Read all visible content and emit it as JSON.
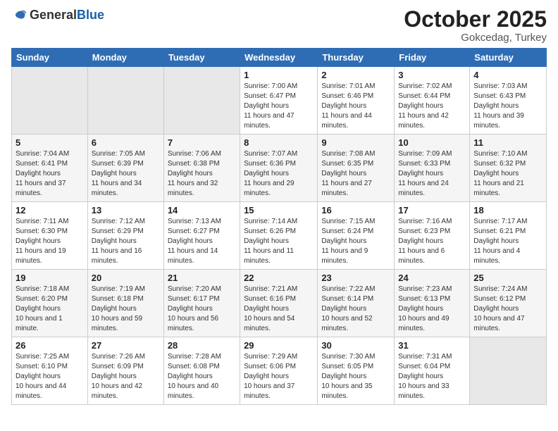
{
  "logo": {
    "general": "General",
    "blue": "Blue"
  },
  "title": {
    "month": "October 2025",
    "location": "Gokcedag, Turkey"
  },
  "weekdays": [
    "Sunday",
    "Monday",
    "Tuesday",
    "Wednesday",
    "Thursday",
    "Friday",
    "Saturday"
  ],
  "weeks": [
    [
      {
        "day": "",
        "sunrise": "",
        "sunset": "",
        "daylight": ""
      },
      {
        "day": "",
        "sunrise": "",
        "sunset": "",
        "daylight": ""
      },
      {
        "day": "",
        "sunrise": "",
        "sunset": "",
        "daylight": ""
      },
      {
        "day": "1",
        "sunrise": "7:00 AM",
        "sunset": "6:47 PM",
        "daylight": "11 hours and 47 minutes."
      },
      {
        "day": "2",
        "sunrise": "7:01 AM",
        "sunset": "6:46 PM",
        "daylight": "11 hours and 44 minutes."
      },
      {
        "day": "3",
        "sunrise": "7:02 AM",
        "sunset": "6:44 PM",
        "daylight": "11 hours and 42 minutes."
      },
      {
        "day": "4",
        "sunrise": "7:03 AM",
        "sunset": "6:43 PM",
        "daylight": "11 hours and 39 minutes."
      }
    ],
    [
      {
        "day": "5",
        "sunrise": "7:04 AM",
        "sunset": "6:41 PM",
        "daylight": "11 hours and 37 minutes."
      },
      {
        "day": "6",
        "sunrise": "7:05 AM",
        "sunset": "6:39 PM",
        "daylight": "11 hours and 34 minutes."
      },
      {
        "day": "7",
        "sunrise": "7:06 AM",
        "sunset": "6:38 PM",
        "daylight": "11 hours and 32 minutes."
      },
      {
        "day": "8",
        "sunrise": "7:07 AM",
        "sunset": "6:36 PM",
        "daylight": "11 hours and 29 minutes."
      },
      {
        "day": "9",
        "sunrise": "7:08 AM",
        "sunset": "6:35 PM",
        "daylight": "11 hours and 27 minutes."
      },
      {
        "day": "10",
        "sunrise": "7:09 AM",
        "sunset": "6:33 PM",
        "daylight": "11 hours and 24 minutes."
      },
      {
        "day": "11",
        "sunrise": "7:10 AM",
        "sunset": "6:32 PM",
        "daylight": "11 hours and 21 minutes."
      }
    ],
    [
      {
        "day": "12",
        "sunrise": "7:11 AM",
        "sunset": "6:30 PM",
        "daylight": "11 hours and 19 minutes."
      },
      {
        "day": "13",
        "sunrise": "7:12 AM",
        "sunset": "6:29 PM",
        "daylight": "11 hours and 16 minutes."
      },
      {
        "day": "14",
        "sunrise": "7:13 AM",
        "sunset": "6:27 PM",
        "daylight": "11 hours and 14 minutes."
      },
      {
        "day": "15",
        "sunrise": "7:14 AM",
        "sunset": "6:26 PM",
        "daylight": "11 hours and 11 minutes."
      },
      {
        "day": "16",
        "sunrise": "7:15 AM",
        "sunset": "6:24 PM",
        "daylight": "11 hours and 9 minutes."
      },
      {
        "day": "17",
        "sunrise": "7:16 AM",
        "sunset": "6:23 PM",
        "daylight": "11 hours and 6 minutes."
      },
      {
        "day": "18",
        "sunrise": "7:17 AM",
        "sunset": "6:21 PM",
        "daylight": "11 hours and 4 minutes."
      }
    ],
    [
      {
        "day": "19",
        "sunrise": "7:18 AM",
        "sunset": "6:20 PM",
        "daylight": "10 hours and 1 minute."
      },
      {
        "day": "20",
        "sunrise": "7:19 AM",
        "sunset": "6:18 PM",
        "daylight": "10 hours and 59 minutes."
      },
      {
        "day": "21",
        "sunrise": "7:20 AM",
        "sunset": "6:17 PM",
        "daylight": "10 hours and 56 minutes."
      },
      {
        "day": "22",
        "sunrise": "7:21 AM",
        "sunset": "6:16 PM",
        "daylight": "10 hours and 54 minutes."
      },
      {
        "day": "23",
        "sunrise": "7:22 AM",
        "sunset": "6:14 PM",
        "daylight": "10 hours and 52 minutes."
      },
      {
        "day": "24",
        "sunrise": "7:23 AM",
        "sunset": "6:13 PM",
        "daylight": "10 hours and 49 minutes."
      },
      {
        "day": "25",
        "sunrise": "7:24 AM",
        "sunset": "6:12 PM",
        "daylight": "10 hours and 47 minutes."
      }
    ],
    [
      {
        "day": "26",
        "sunrise": "7:25 AM",
        "sunset": "6:10 PM",
        "daylight": "10 hours and 44 minutes."
      },
      {
        "day": "27",
        "sunrise": "7:26 AM",
        "sunset": "6:09 PM",
        "daylight": "10 hours and 42 minutes."
      },
      {
        "day": "28",
        "sunrise": "7:28 AM",
        "sunset": "6:08 PM",
        "daylight": "10 hours and 40 minutes."
      },
      {
        "day": "29",
        "sunrise": "7:29 AM",
        "sunset": "6:06 PM",
        "daylight": "10 hours and 37 minutes."
      },
      {
        "day": "30",
        "sunrise": "7:30 AM",
        "sunset": "6:05 PM",
        "daylight": "10 hours and 35 minutes."
      },
      {
        "day": "31",
        "sunrise": "7:31 AM",
        "sunset": "6:04 PM",
        "daylight": "10 hours and 33 minutes."
      },
      {
        "day": "",
        "sunrise": "",
        "sunset": "",
        "daylight": ""
      }
    ]
  ],
  "labels": {
    "sunrise": "Sunrise:",
    "sunset": "Sunset:",
    "daylight": "Daylight hours"
  }
}
